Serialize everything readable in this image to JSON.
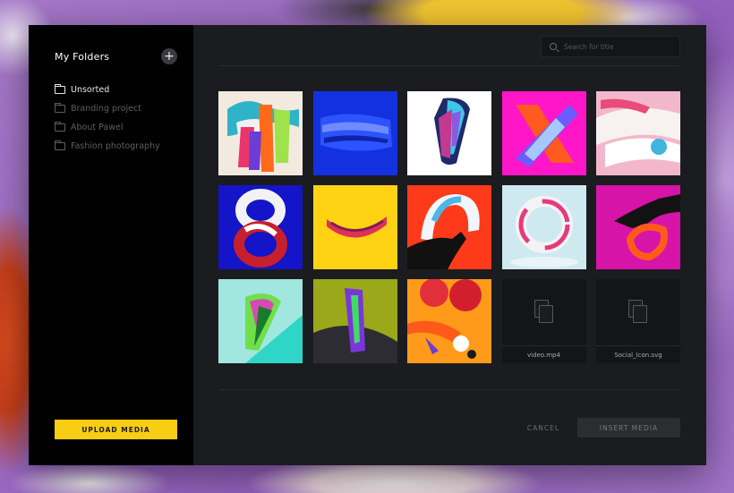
{
  "sidebar": {
    "title": "My Folders",
    "add_icon": "plus-icon",
    "folders": [
      {
        "label": "Unsorted",
        "active": true
      },
      {
        "label": "Branding project",
        "active": false
      },
      {
        "label": "About Pawel",
        "active": false
      },
      {
        "label": "Fashion photography",
        "active": false
      }
    ],
    "upload_label": "UPLOAD MEDIA"
  },
  "search": {
    "placeholder": "Search for title",
    "value": ""
  },
  "files": [
    {
      "name": "video.mp4",
      "icon": "file-icon"
    },
    {
      "name": "Social_Icon.svg",
      "icon": "file-icon"
    }
  ],
  "footer": {
    "cancel_label": "CANCEL",
    "insert_label": "INSERT MEDIA"
  },
  "colors": {
    "accent": "#f8cd14",
    "modal_bg": "#1b1c1f",
    "sidebar_bg": "#000000"
  }
}
